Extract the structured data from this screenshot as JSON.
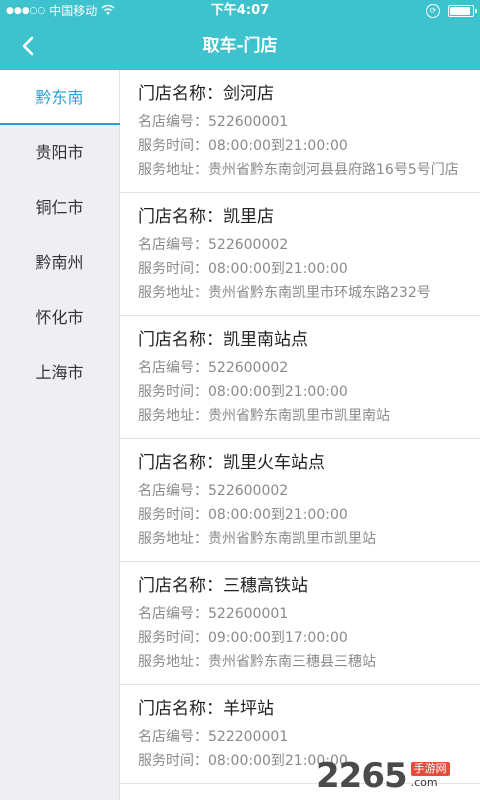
{
  "status_bar": {
    "signal": "●●●○○",
    "carrier": "中国移动",
    "wifi_icon": "wifi-icon",
    "time": "下午4:07",
    "lock_icon": "rotation-lock-icon",
    "battery_icon": "battery-icon"
  },
  "nav": {
    "title": "取车-门店",
    "back_icon": "chevron-left-icon"
  },
  "colors": {
    "header": "#3ec3ce",
    "accent": "#2a9fd6",
    "sidebar_bg": "#eeeef3"
  },
  "sidebar": {
    "items": [
      {
        "label": "黔东南",
        "active": true
      },
      {
        "label": "贵阳市",
        "active": false
      },
      {
        "label": "铜仁市",
        "active": false
      },
      {
        "label": "黔南州",
        "active": false
      },
      {
        "label": "怀化市",
        "active": false
      },
      {
        "label": "上海市",
        "active": false
      }
    ]
  },
  "labels": {
    "name": "门店名称：",
    "code": "名店编号：",
    "hours": "服务时间：",
    "address": "服务地址："
  },
  "stores": [
    {
      "name": "剑河店",
      "code": "522600001",
      "hours": "08:00:00到21:00:00",
      "address": "贵州省黔东南剑河县县府路16号5号门店"
    },
    {
      "name": "凯里店",
      "code": "522600002",
      "hours": "08:00:00到21:00:00",
      "address": "贵州省黔东南凯里市环城东路232号"
    },
    {
      "name": "凯里南站点",
      "code": "522600002",
      "hours": "08:00:00到21:00:00",
      "address": "贵州省黔东南凯里市凯里南站"
    },
    {
      "name": "凯里火车站点",
      "code": "522600002",
      "hours": "08:00:00到21:00:00",
      "address": "贵州省黔东南凯里市凯里站"
    },
    {
      "name": "三穗高铁站",
      "code": "522600001",
      "hours": "09:00:00到17:00:00",
      "address": "贵州省黔东南三穗县三穗站"
    },
    {
      "name": "羊坪站",
      "code": "522200001",
      "hours": "08:00:00到21:00:00",
      "address": ""
    }
  ],
  "watermark": {
    "number": "2265",
    "suffix": "手游网",
    "domain": ".com"
  }
}
